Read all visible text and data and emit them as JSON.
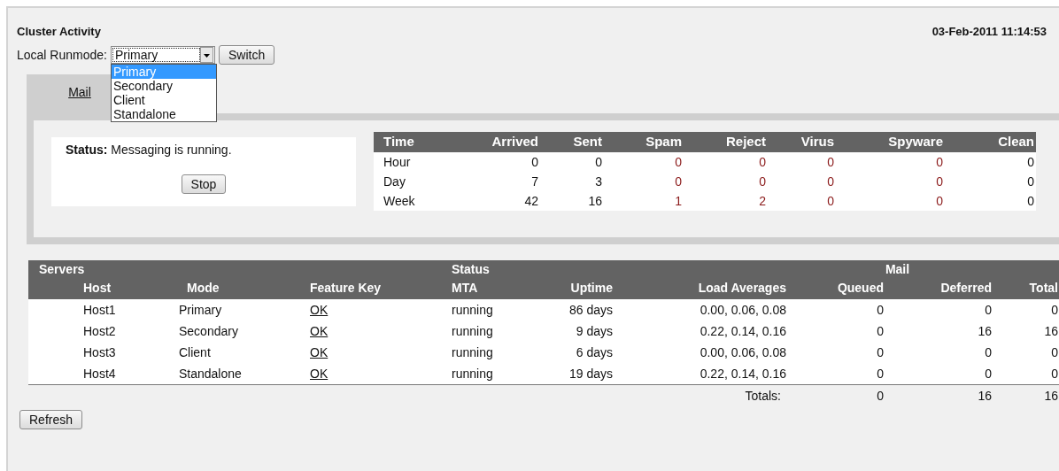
{
  "header": {
    "title": "Cluster Activity",
    "timestamp": "03-Feb-2011 11:14:53"
  },
  "runmode": {
    "label": "Local Runmode:",
    "value": "Primary",
    "button": "Switch",
    "expanded": true,
    "options": [
      {
        "label": "Primary",
        "selected": true
      },
      {
        "label": "Secondary",
        "selected": false
      },
      {
        "label": "Client",
        "selected": false
      },
      {
        "label": "Standalone",
        "selected": false
      }
    ]
  },
  "tabs": [
    {
      "label": "Mail",
      "selected": true
    }
  ],
  "status": {
    "label": "Status:",
    "text": "Messaging is running.",
    "button": "Stop"
  },
  "stats": {
    "columns": [
      {
        "label": "Time",
        "alert": false
      },
      {
        "label": "Arrived",
        "alert": false
      },
      {
        "label": "Sent",
        "alert": false
      },
      {
        "label": "Spam",
        "alert": true
      },
      {
        "label": "Reject",
        "alert": true
      },
      {
        "label": "Virus",
        "alert": true
      },
      {
        "label": "Spyware",
        "alert": true
      },
      {
        "label": "Clean",
        "alert": false
      }
    ],
    "rows": [
      [
        "Hour",
        "0",
        "0",
        "0",
        "0",
        "0",
        "0",
        "0"
      ],
      [
        "Day",
        "7",
        "3",
        "0",
        "0",
        "0",
        "0",
        "0"
      ],
      [
        "Week",
        "42",
        "16",
        "1",
        "2",
        "0",
        "0",
        "0"
      ]
    ]
  },
  "servers": {
    "groups": [
      {
        "label": "Servers",
        "columns": [
          "Host",
          "Mode",
          "Feature Key"
        ]
      },
      {
        "label": "Status",
        "columns": [
          "MTA",
          "Uptime",
          "Load Averages"
        ]
      },
      {
        "label": "Mail",
        "columns": [
          "Queued",
          "Deferred",
          "Total"
        ]
      }
    ],
    "rows": [
      {
        "host": "Host1",
        "mode": "Primary",
        "feature_key": "OK",
        "mta": "running",
        "uptime": "86 days",
        "load": "0.00, 0.06, 0.08",
        "queued": "0",
        "deferred": "0",
        "total": "0"
      },
      {
        "host": "Host2",
        "mode": "Secondary",
        "feature_key": "OK",
        "mta": "running",
        "uptime": "9 days",
        "load": "0.22, 0.14, 0.16",
        "queued": "0",
        "deferred": "16",
        "total": "16"
      },
      {
        "host": "Host3",
        "mode": "Client",
        "feature_key": "OK",
        "mta": "running",
        "uptime": "6 days",
        "load": "0.00, 0.06, 0.08",
        "queued": "0",
        "deferred": "0",
        "total": "0"
      },
      {
        "host": "Host4",
        "mode": "Standalone",
        "feature_key": "OK",
        "mta": "running",
        "uptime": "19 days",
        "load": "0.22, 0.14, 0.16",
        "queued": "0",
        "deferred": "0",
        "total": "0"
      }
    ],
    "totals": {
      "label": "Totals:",
      "queued": "0",
      "deferred": "16",
      "total": "16"
    }
  },
  "refresh_button": "Refresh"
}
